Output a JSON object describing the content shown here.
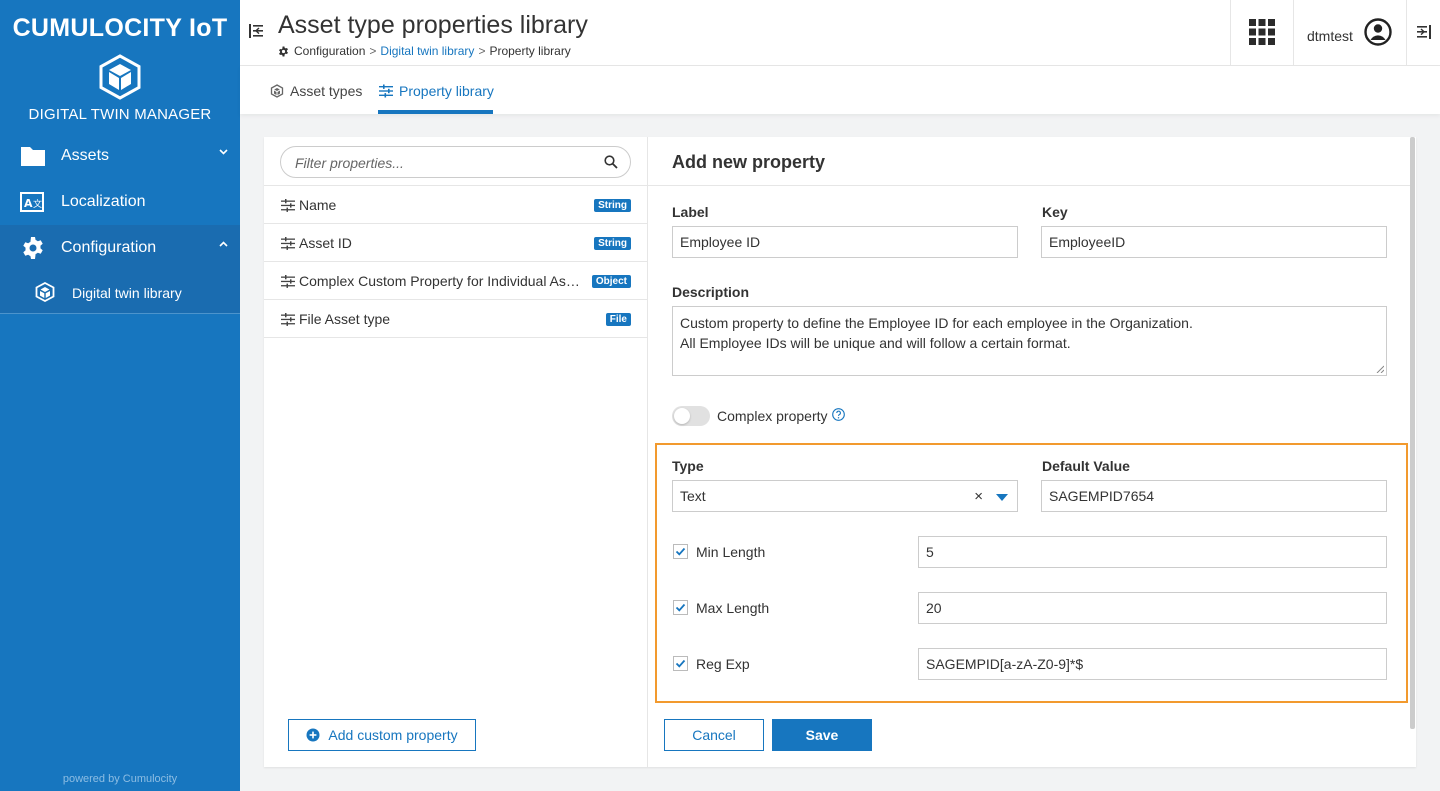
{
  "sidebar": {
    "brand": "CUMULOCITY IoT",
    "app_name": "DIGITAL TWIN MANAGER",
    "items": [
      {
        "label": "Assets",
        "icon": "folder-icon"
      },
      {
        "label": "Localization",
        "icon": "translate-icon"
      },
      {
        "label": "Configuration",
        "icon": "gear-icon"
      }
    ],
    "sub_item": {
      "label": "Digital twin library",
      "icon": "cube-icon"
    },
    "powered_by": "powered by Cumulocity"
  },
  "header": {
    "title": "Asset type properties library",
    "breadcrumb": [
      "Configuration",
      "Digital twin library",
      "Property library"
    ],
    "breadcrumb_sep": ">",
    "user": "dtmtest"
  },
  "tabs": [
    {
      "label": "Asset types",
      "icon": "cube-outline-icon"
    },
    {
      "label": "Property library",
      "icon": "sliders-icon",
      "active": true
    }
  ],
  "properties": {
    "filter_placeholder": "Filter properties...",
    "items": [
      {
        "name": "Name",
        "type": "String"
      },
      {
        "name": "Asset ID",
        "type": "String"
      },
      {
        "name": "Complex Custom Property for Individual Assets",
        "type": "Object"
      },
      {
        "name": "File Asset type",
        "type": "File"
      }
    ],
    "add_label": "Add custom property"
  },
  "form": {
    "title": "Add new property",
    "label_label": "Label",
    "label_value": "Employee ID",
    "key_label": "Key",
    "key_value": "EmployeeID",
    "description_label": "Description",
    "description_line1": "Custom property to define the Employee ID for each employee in the Organization.",
    "description_line2": "All Employee IDs will be unique and will follow a certain format.",
    "complex_label": "Complex property",
    "complex_on": false,
    "type_label": "Type",
    "type_value": "Text",
    "clear_glyph": "×",
    "default_label": "Default Value",
    "default_value": "SAGEMPID7654",
    "min_label": "Min Length",
    "min_value": "5",
    "max_label": "Max Length",
    "max_value": "20",
    "regex_label": "Reg Exp",
    "regex_value": "SAGEMPID[a-zA-Z0-9]*$",
    "cancel_label": "Cancel",
    "save_label": "Save"
  },
  "colors": {
    "primary": "#1776bf",
    "highlight": "#f29a2e"
  }
}
